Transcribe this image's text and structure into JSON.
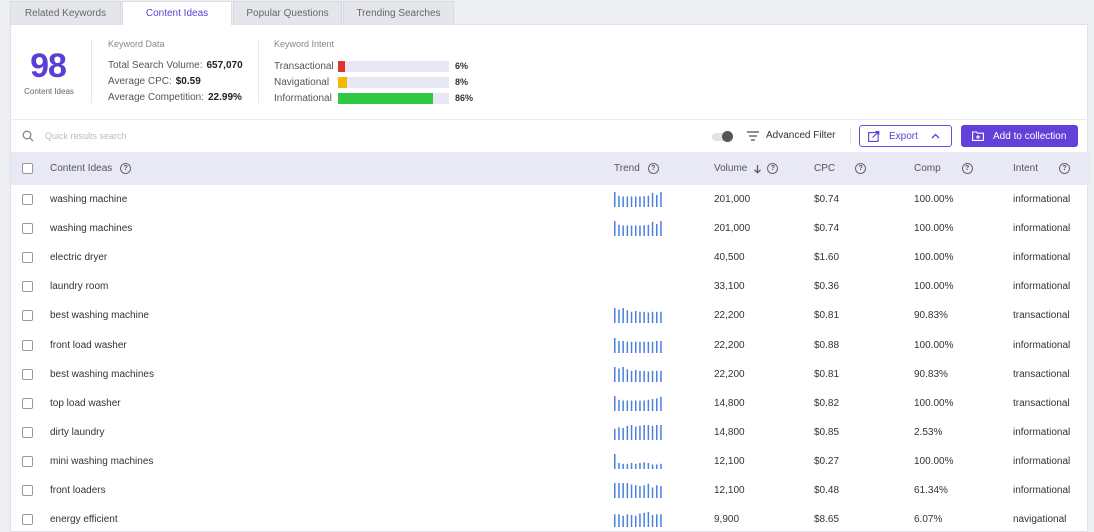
{
  "tabs": [
    {
      "label": "Related Keywords",
      "active": false
    },
    {
      "label": "Content Ideas",
      "active": true
    },
    {
      "label": "Popular Questions",
      "active": false
    },
    {
      "label": "Trending Searches",
      "active": false
    }
  ],
  "summary": {
    "count": "98",
    "count_label": "Content Ideas",
    "keyword_data": {
      "title": "Keyword Data",
      "total_search_volume_label": "Total Search Volume:",
      "total_search_volume": "657,070",
      "average_cpc_label": "Average CPC:",
      "average_cpc": "$0.59",
      "average_competition_label": "Average Competition:",
      "average_competition": "22.99%"
    },
    "keyword_intent": {
      "title": "Keyword Intent",
      "items": [
        {
          "label": "Transactional",
          "pct": "6%",
          "value": 6,
          "color": "#e0342a"
        },
        {
          "label": "Navigational",
          "pct": "8%",
          "value": 8,
          "color": "#f5b800"
        },
        {
          "label": "Informational",
          "pct": "86%",
          "value": 86,
          "color": "#2fc944"
        }
      ]
    }
  },
  "toolbar": {
    "search_placeholder": "Quick results search",
    "advanced_filter_label": "Advanced Filter",
    "export_label": "Export",
    "add_to_collection_label": "Add to collection",
    "accent_color": "#6340d8"
  },
  "table": {
    "columns": {
      "content_ideas": "Content Ideas",
      "trend": "Trend",
      "volume": "Volume",
      "cpc": "CPC",
      "comp": "Comp",
      "intent": "Intent"
    },
    "rows": [
      {
        "keyword": "washing machine",
        "volume": "201,000",
        "cpc": "$0.74",
        "comp": "100.00%",
        "intent": "informational",
        "trend": [
          1.0,
          0.75,
          0.7,
          0.7,
          0.7,
          0.7,
          0.7,
          0.72,
          0.75,
          0.95,
          0.8,
          1.0
        ]
      },
      {
        "keyword": "washing machines",
        "volume": "201,000",
        "cpc": "$0.74",
        "comp": "100.00%",
        "intent": "informational",
        "trend": [
          1.0,
          0.75,
          0.7,
          0.7,
          0.7,
          0.7,
          0.7,
          0.72,
          0.75,
          0.95,
          0.8,
          1.0
        ]
      },
      {
        "keyword": "electric dryer",
        "volume": "40,500",
        "cpc": "$1.60",
        "comp": "100.00%",
        "intent": "informational",
        "trend": []
      },
      {
        "keyword": "laundry room",
        "volume": "33,100",
        "cpc": "$0.36",
        "comp": "100.00%",
        "intent": "informational",
        "trend": []
      },
      {
        "keyword": "best washing machine",
        "volume": "22,200",
        "cpc": "$0.81",
        "comp": "90.83%",
        "intent": "transactional",
        "trend": [
          1.0,
          0.9,
          1.0,
          0.85,
          0.75,
          0.8,
          0.75,
          0.75,
          0.7,
          0.75,
          0.75,
          0.75
        ]
      },
      {
        "keyword": "front load washer",
        "volume": "22,200",
        "cpc": "$0.88",
        "comp": "100.00%",
        "intent": "informational",
        "trend": [
          1.0,
          0.8,
          0.8,
          0.75,
          0.75,
          0.75,
          0.75,
          0.75,
          0.75,
          0.75,
          0.8,
          0.8
        ]
      },
      {
        "keyword": "best washing machines",
        "volume": "22,200",
        "cpc": "$0.81",
        "comp": "90.83%",
        "intent": "transactional",
        "trend": [
          1.0,
          0.9,
          1.0,
          0.85,
          0.75,
          0.8,
          0.75,
          0.75,
          0.7,
          0.75,
          0.75,
          0.75
        ]
      },
      {
        "keyword": "top load washer",
        "volume": "14,800",
        "cpc": "$0.82",
        "comp": "100.00%",
        "intent": "transactional",
        "trend": [
          1.0,
          0.75,
          0.7,
          0.7,
          0.7,
          0.7,
          0.7,
          0.7,
          0.75,
          0.8,
          0.85,
          0.95
        ]
      },
      {
        "keyword": "dirty laundry",
        "volume": "14,800",
        "cpc": "$0.85",
        "comp": "2.53%",
        "intent": "informational",
        "trend": [
          0.75,
          0.85,
          0.8,
          0.95,
          1.0,
          0.9,
          0.95,
          1.0,
          1.0,
          0.95,
          1.0,
          1.0
        ]
      },
      {
        "keyword": "mini washing machines",
        "volume": "12,100",
        "cpc": "$0.27",
        "comp": "100.00%",
        "intent": "informational",
        "trend": [
          1.0,
          0.4,
          0.35,
          0.35,
          0.4,
          0.35,
          0.4,
          0.45,
          0.4,
          0.3,
          0.3,
          0.35
        ]
      },
      {
        "keyword": "front loaders",
        "volume": "12,100",
        "cpc": "$0.48",
        "comp": "61.34%",
        "intent": "informational",
        "trend": [
          1.0,
          1.0,
          1.0,
          1.0,
          0.9,
          0.85,
          0.8,
          0.85,
          0.95,
          0.7,
          0.85,
          0.8
        ]
      },
      {
        "keyword": "energy efficient",
        "volume": "9,900",
        "cpc": "$8.65",
        "comp": "6.07%",
        "intent": "navigational",
        "trend": [
          0.85,
          0.85,
          0.75,
          0.85,
          0.8,
          0.75,
          0.9,
          0.95,
          1.0,
          0.8,
          0.85,
          0.85
        ]
      }
    ],
    "trend_color": "#4a7fe0"
  }
}
